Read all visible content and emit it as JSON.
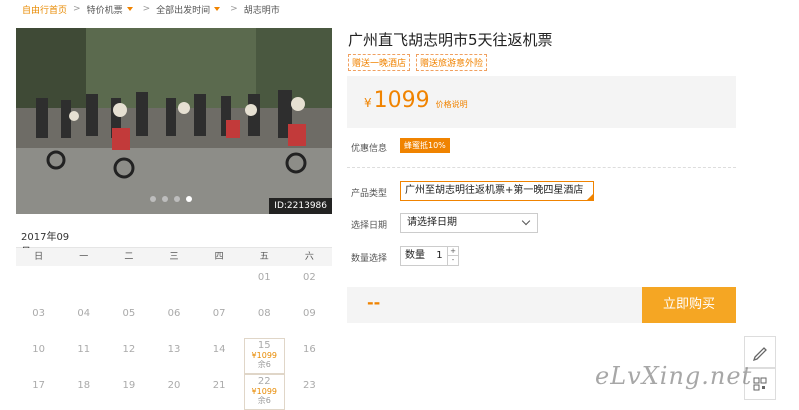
{
  "breadcrumb": {
    "home": "自由行首页",
    "items": [
      "特价机票",
      "全部出发时间",
      "胡志明市"
    ]
  },
  "photo": {
    "id_label": "ID:2213986",
    "dots": [
      false,
      false,
      false,
      true
    ]
  },
  "calendar": {
    "month": "2017年09月",
    "weekdays": [
      "日",
      "一",
      "二",
      "三",
      "四",
      "五",
      "六"
    ],
    "rows": [
      [
        "",
        "",
        "",
        "",
        "",
        "01",
        "02"
      ],
      [
        "03",
        "04",
        "05",
        "06",
        "07",
        "08",
        "09"
      ],
      [
        "10",
        "11",
        "12",
        "13",
        "14",
        "15",
        "16"
      ],
      [
        "17",
        "18",
        "19",
        "20",
        "21",
        "22",
        "23"
      ]
    ],
    "priced": {
      "15": {
        "price": "¥1099",
        "left": "余6"
      },
      "22": {
        "price": "¥1099",
        "left": "余6"
      }
    }
  },
  "product": {
    "title": "广州直飞胡志明市5天往返机票",
    "tags": [
      "赠送一晚酒店",
      "赠送旅游意外险"
    ],
    "price_currency": "¥",
    "price": "1099",
    "price_explain": "价格说明",
    "discount_label": "优惠信息",
    "discount_badge": "蜂蜜抵10%",
    "type_label": "产品类型",
    "type_value": "广州至胡志明往返机票+第一晚四星酒店",
    "date_label": "选择日期",
    "date_placeholder": "请选择日期",
    "qty_label": "数量选择",
    "qty_prefix": "数量",
    "qty_value": "1",
    "total": "--",
    "buy_label": "立即购买"
  },
  "watermark": "eLvXing.net",
  "colors": {
    "accent": "#f08300",
    "button": "#f5a623"
  }
}
